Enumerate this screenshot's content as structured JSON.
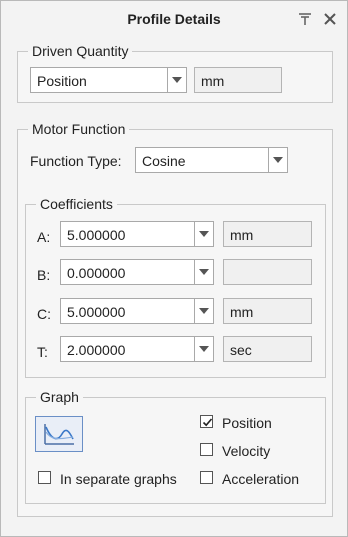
{
  "window": {
    "title": "Profile Details"
  },
  "driven_quantity": {
    "legend": "Driven Quantity",
    "value": "Position",
    "unit": "mm"
  },
  "motor_function": {
    "legend": "Motor Function",
    "function_type_label": "Function Type:",
    "function_type_value": "Cosine"
  },
  "coefficients": {
    "legend": "Coefficients",
    "rows": [
      {
        "label": "A:",
        "value": "5.000000",
        "unit": "mm"
      },
      {
        "label": "B:",
        "value": "0.000000",
        "unit": ""
      },
      {
        "label": "C:",
        "value": "5.000000",
        "unit": "mm"
      },
      {
        "label": "T:",
        "value": "2.000000",
        "unit": "sec"
      }
    ]
  },
  "graph": {
    "legend": "Graph",
    "separate_graphs_label": "In separate graphs",
    "separate_graphs_checked": false,
    "position_label": "Position",
    "position_checked": true,
    "velocity_label": "Velocity",
    "velocity_checked": false,
    "acceleration_label": "Acceleration",
    "acceleration_checked": false
  },
  "icons": {
    "pin": "pin-icon",
    "close": "close-icon",
    "dropdown": "chevron-down-icon",
    "graph": "graph-curve-icon",
    "check": "checkmark-icon"
  }
}
